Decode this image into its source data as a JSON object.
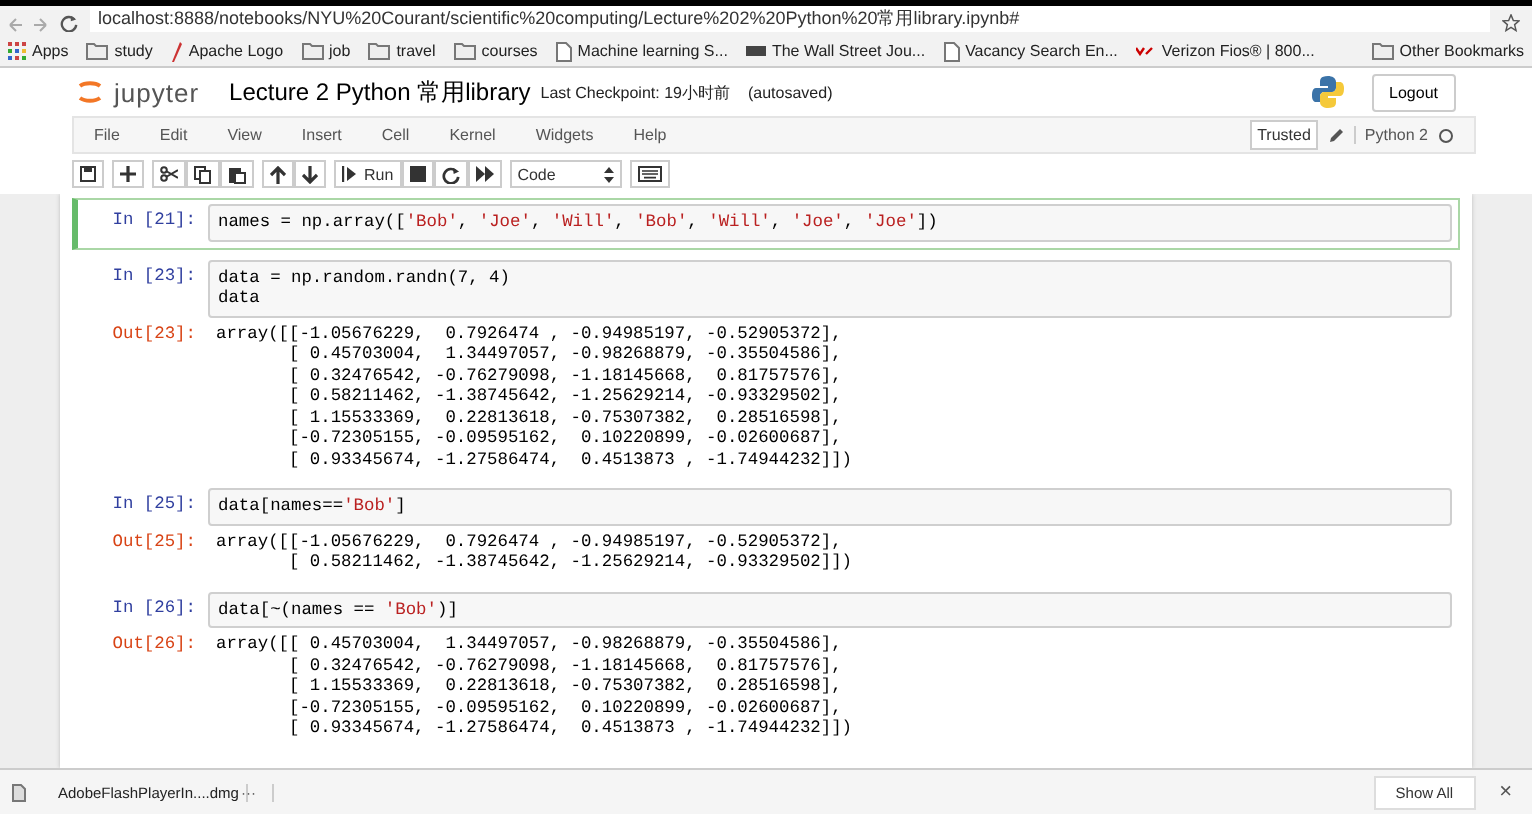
{
  "browser": {
    "url": "localhost:8888/notebooks/NYU%20Courant/scientific%20computing/Lecture%202%20Python%20常用library.ipynb#",
    "bookmarks": [
      {
        "label": "Apps",
        "kind": "apps"
      },
      {
        "label": "study",
        "kind": "folder"
      },
      {
        "label": "Apache Logo",
        "kind": "feather"
      },
      {
        "label": "job",
        "kind": "folder"
      },
      {
        "label": "travel",
        "kind": "folder"
      },
      {
        "label": "courses",
        "kind": "folder"
      },
      {
        "label": "Machine learning S...",
        "kind": "page"
      },
      {
        "label": "The Wall Street Jou...",
        "kind": "wsj"
      },
      {
        "label": "Vacancy Search En...",
        "kind": "page"
      },
      {
        "label": "Verizon Fios® | 800...",
        "kind": "verizon"
      }
    ],
    "other_bookmarks": "Other Bookmarks"
  },
  "header": {
    "logo": "jupyter",
    "title": "Lecture 2 Python 常用library",
    "checkpoint": "Last Checkpoint: 19小时前",
    "autosaved": "(autosaved)",
    "logout": "Logout"
  },
  "menu": [
    "File",
    "Edit",
    "View",
    "Insert",
    "Cell",
    "Kernel",
    "Widgets",
    "Help"
  ],
  "trusted": "Trusted",
  "kernel": "Python 2",
  "toolbar": {
    "run": "Run",
    "cell_type": "Code"
  },
  "cells": [
    {
      "prompt": "In [21]:",
      "selected": true,
      "code": [
        "names = np.array(['Bob', 'Joe', 'Will', 'Bob', 'Will', 'Joe', 'Joe'])"
      ]
    },
    {
      "prompt": "In [23]:",
      "selected": false,
      "code": [
        "data = np.random.randn(7, 4)",
        "data"
      ],
      "out_prompt": "Out[23]:",
      "output": [
        "array([[-1.05676229,  0.7926474 , -0.94985197, -0.52905372],",
        "       [ 0.45703004,  1.34497057, -0.98268879, -0.35504586],",
        "       [ 0.32476542, -0.76279098, -1.18145668,  0.81757576],",
        "       [ 0.58211462, -1.38745642, -1.25629214, -0.93329502],",
        "       [ 1.15533369,  0.22813618, -0.75307382,  0.28516598],",
        "       [-0.72305155, -0.09595162,  0.10220899, -0.02600687],",
        "       [ 0.93345674, -1.27586474,  0.4513873 , -1.74944232]])"
      ]
    },
    {
      "prompt": "In [25]:",
      "selected": false,
      "code": [
        "data[names=='Bob']"
      ],
      "out_prompt": "Out[25]:",
      "output": [
        "array([[-1.05676229,  0.7926474 , -0.94985197, -0.52905372],",
        "       [ 0.58211462, -1.38745642, -1.25629214, -0.93329502]])"
      ]
    },
    {
      "prompt": "In [26]:",
      "selected": false,
      "code": [
        "data[~(names == 'Bob')]"
      ],
      "out_prompt": "Out[26]:",
      "output": [
        "array([[ 0.45703004,  1.34497057, -0.98268879, -0.35504586],",
        "       [ 0.32476542, -0.76279098, -1.18145668,  0.81757576],",
        "       [ 1.15533369,  0.22813618, -0.75307382,  0.28516598],",
        "       [-0.72305155, -0.09595162,  0.10220899, -0.02600687],",
        "       [ 0.93345674, -1.27586474,  0.4513873 , -1.74944232]])"
      ]
    }
  ],
  "download": {
    "file": "AdobeFlashPlayerIn....dmg",
    "more": "···",
    "show_all": "Show All",
    "close": "×"
  }
}
